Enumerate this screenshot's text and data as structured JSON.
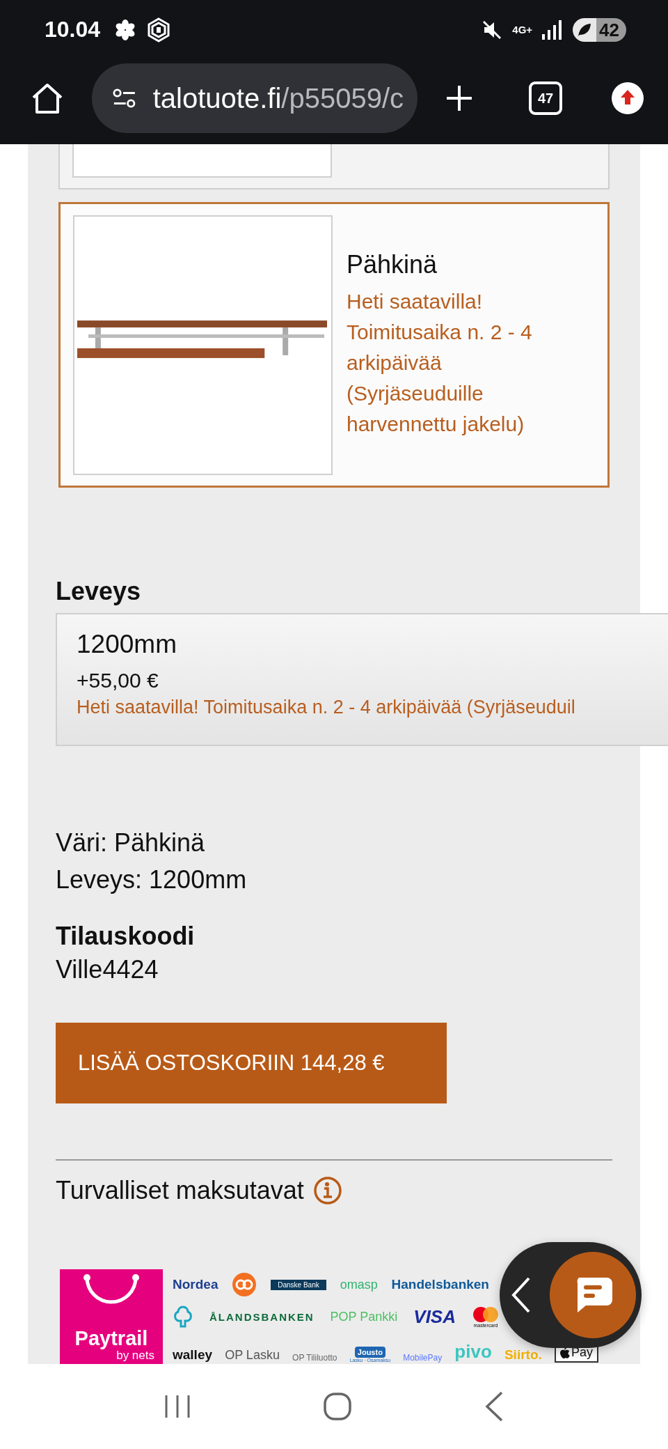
{
  "status_bar": {
    "time": "10.04",
    "network": "4G+",
    "battery": "42"
  },
  "browser": {
    "url_domain": "talotuote.fi",
    "url_path": "/p55059/c",
    "tab_count": "47"
  },
  "variants": [
    {
      "selected": false
    },
    {
      "name": "Pähkinä",
      "availability": "Heti saatavilla! Toimitusaika n. 2 - 4 arkipäivää (Syrjäseuduille harvennettu jakelu)",
      "selected": true
    }
  ],
  "width_option": {
    "label": "Leveys",
    "value": "1200mm",
    "price": "+55,00 €",
    "availability": "Heti saatavilla! Toimitusaika n. 2 - 4 arkipäivää (Syrjäseuduil"
  },
  "summary": [
    "Väri: Pähkinä",
    "Leveys: 1200mm"
  ],
  "order_code": {
    "label": "Tilauskoodi",
    "value": "Ville4424"
  },
  "add_to_cart": "LISÄÄ OSTOSKORIIN 144,28 €",
  "payments": {
    "title": "Turvalliset maksutavat",
    "provider": {
      "name": "Paytrail",
      "sub": "by nets"
    },
    "rows": [
      {
        "logos": [
          {
            "kind": "text",
            "label": "Nordea",
            "color": "#1d3f8f"
          },
          {
            "kind": "op",
            "color": "#f37021"
          },
          {
            "kind": "banner",
            "label": "Danske Bank",
            "color": "#0b3a5b"
          },
          {
            "kind": "light",
            "label": "omasp",
            "color": "#2fb36f"
          },
          {
            "kind": "text",
            "label": "Handelsbanken",
            "color": "#0f5a99"
          }
        ]
      },
      {
        "logos": [
          {
            "kind": "tree",
            "color": "#1aa6c2"
          },
          {
            "kind": "spaced",
            "label": "ÅLANDSBANKEN",
            "color": "#0c6b3b"
          },
          {
            "kind": "light",
            "label": "POP Pankki",
            "color": "#4cbf63"
          },
          {
            "kind": "italic",
            "label": "VISA",
            "color": "#1a2a9c"
          },
          {
            "kind": "mastercard",
            "label": "mastercard",
            "color": "#eb001b"
          }
        ]
      },
      {
        "logos": [
          {
            "kind": "text",
            "label": "walley",
            "color": "#111111"
          },
          {
            "kind": "light",
            "label": "OP Lasku",
            "color": "#555555"
          },
          {
            "kind": "small",
            "label": "OP Tililuotto",
            "color": "#666666"
          },
          {
            "kind": "badge",
            "label": "Jousto",
            "sub": "Lasku · Osamaksu",
            "color": "#1f66b0"
          },
          {
            "kind": "small",
            "label": "MobilePay",
            "color": "#5a78ff"
          },
          {
            "kind": "big",
            "label": "pivo",
            "color": "#3cc6c0"
          },
          {
            "kind": "text",
            "label": "Siirto.",
            "color": "#f0b000"
          },
          {
            "kind": "applepay",
            "label": "Pay",
            "color": "#111111"
          }
        ]
      }
    ]
  }
}
